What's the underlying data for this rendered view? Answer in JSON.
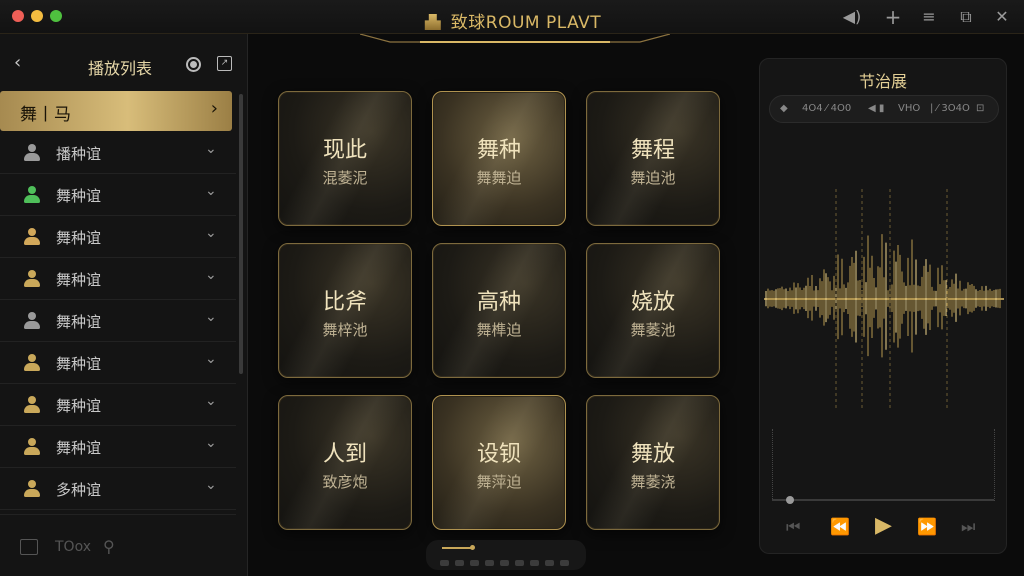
{
  "app": {
    "title": "致球ROUM PLAVT"
  },
  "titlebar_icons": [
    "volume-icon",
    "add-icon",
    "filter-icon",
    "popout-icon",
    "close-icon"
  ],
  "sidebar": {
    "title": "播放列表",
    "active_item": "舞⼁马",
    "items": [
      {
        "label": "播种谊",
        "color": "#9a9a9a"
      },
      {
        "label": "舞种谊",
        "color": "#4fbf5a"
      },
      {
        "label": "舞种谊",
        "color": "#d2a85a"
      },
      {
        "label": "舞种谊",
        "color": "#c9a85a"
      },
      {
        "label": "舞种谊",
        "color": "#9a9a9a"
      },
      {
        "label": "舞种谊",
        "color": "#c9a85a"
      },
      {
        "label": "舞种谊",
        "color": "#c9a85a"
      },
      {
        "label": "舞种谊",
        "color": "#c9a85a"
      },
      {
        "label": "多种谊",
        "color": "#c9a85a"
      }
    ],
    "footer_text": "TOox"
  },
  "tiles": [
    {
      "title": "现此",
      "subtitle": "混萎泥",
      "lit": false
    },
    {
      "title": "舞种",
      "subtitle": "舞舞迫",
      "lit": true
    },
    {
      "title": "舞程",
      "subtitle": "舞迫池",
      "lit": false
    },
    {
      "title": "比斧",
      "subtitle": "舞梓池",
      "lit": false
    },
    {
      "title": "高种",
      "subtitle": "舞榫迫",
      "lit": false
    },
    {
      "title": "娆放",
      "subtitle": "舞萎池",
      "lit": false
    },
    {
      "title": "⼈到",
      "subtitle": "致彦炮",
      "lit": false
    },
    {
      "title": "设钡",
      "subtitle": "舞萍迫",
      "lit": true
    },
    {
      "title": "舞放",
      "subtitle": "舞萎浇",
      "lit": false
    }
  ],
  "panel": {
    "title": "节治展",
    "tools": [
      "◆",
      "4O4 ⁄ 4O0",
      "◀ ▮",
      "VHO",
      "| ⁄ 3O4O",
      "⊡"
    ]
  },
  "accent": "#d9b866"
}
